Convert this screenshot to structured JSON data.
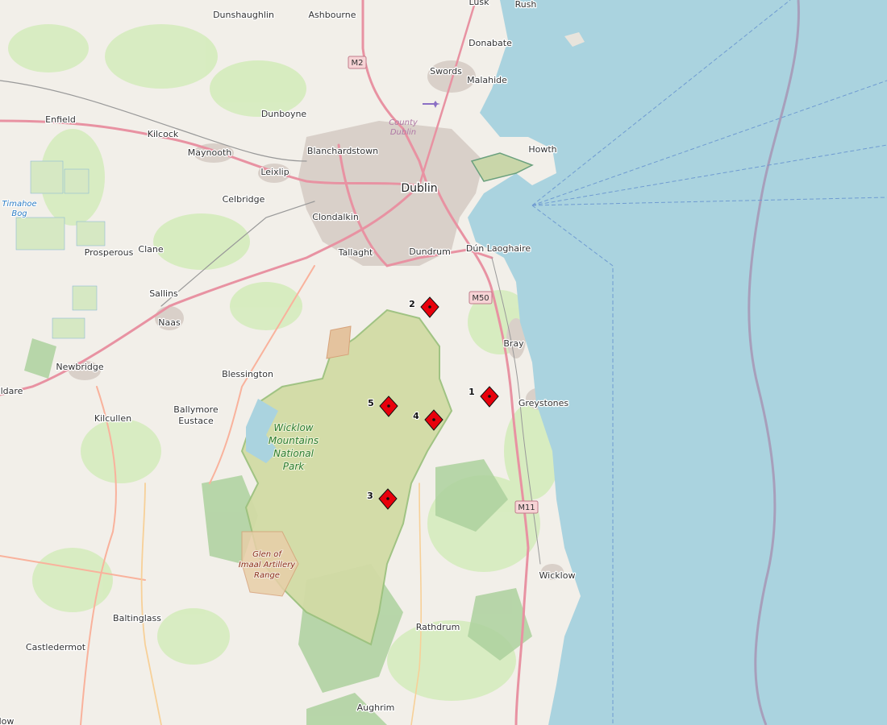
{
  "map": {
    "colors": {
      "sea": "#aad3df",
      "land": "#f2efe9",
      "urban": "#d9d0c9",
      "park": "#c8d7ab",
      "forest": "#add19e",
      "motorway": "#e892a2",
      "trunk": "#f9b29c",
      "marker": "#e8000b"
    },
    "places": [
      "Dunshaughlin",
      "Ashbourne",
      "Lusk",
      "Rush",
      "Donabate",
      "Swords",
      "Malahide",
      "Dunboyne",
      "Enfield",
      "Kilcock",
      "Maynooth",
      "Blanchardstown",
      "Howth",
      "Leixlip",
      "Celbridge",
      "Dublin",
      "Clondalkin",
      "Prosperous",
      "Clane",
      "Tallaght",
      "Dundrum",
      "Dún Laoghaire",
      "Sallins",
      "Naas",
      "Bray",
      "Newbridge",
      "Blessington",
      "Greystones",
      "ildare",
      "Kilcullen",
      "Ballymore",
      "Eustace",
      "Wicklow",
      "Baltinglass",
      "Rathdrum",
      "Castledermot",
      "Aughrim",
      "low"
    ],
    "labels": {
      "county": [
        "County",
        "Dublin"
      ],
      "bog": [
        "Timahoe",
        "Bog"
      ],
      "park": [
        "Wicklow",
        "Mountains",
        "National",
        "Park"
      ],
      "range": [
        "Glen of",
        "Imaal Artillery",
        "Range"
      ]
    },
    "road_shields": [
      "M2",
      "M50",
      "M11"
    ],
    "markers": [
      {
        "label": "1"
      },
      {
        "label": "2"
      },
      {
        "label": "3"
      },
      {
        "label": "4"
      },
      {
        "label": "5"
      }
    ]
  }
}
